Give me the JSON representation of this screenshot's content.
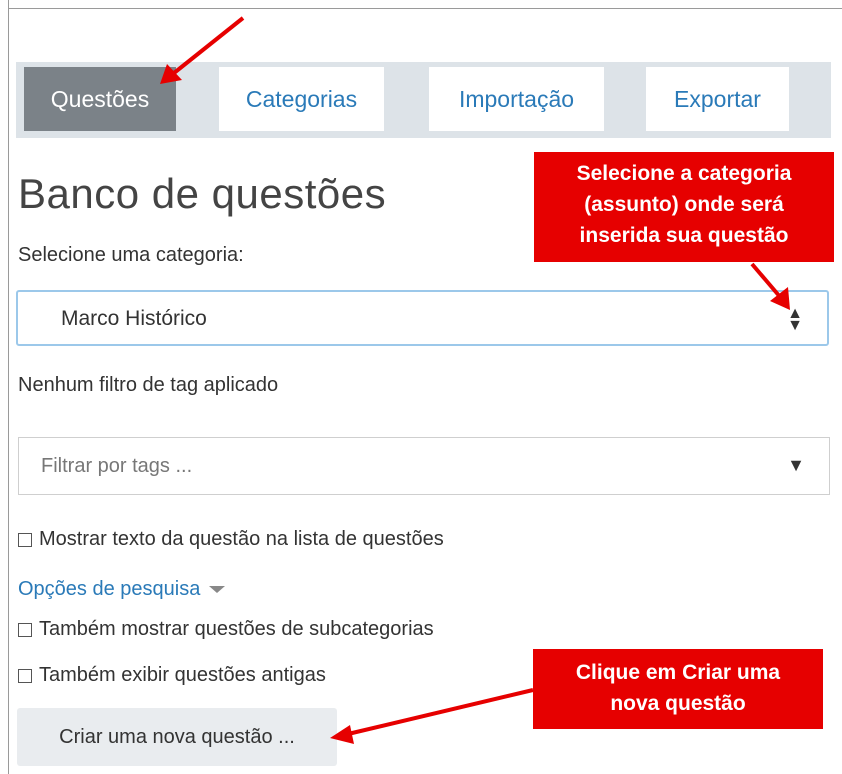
{
  "tabs": [
    {
      "label": "Questões",
      "active": true
    },
    {
      "label": "Categorias",
      "active": false
    },
    {
      "label": "Importação",
      "active": false
    },
    {
      "label": "Exportar",
      "active": false
    }
  ],
  "page_title": "Banco de questões",
  "category": {
    "label": "Selecione uma categoria:",
    "selected": "Marco Histórico"
  },
  "tag_filter": {
    "status": "Nenhum filtro de tag aplicado",
    "placeholder": "Filtrar por tags ..."
  },
  "options": {
    "show_question_text": "Mostrar texto da questão na lista de questões",
    "search_options_link": "Opções de pesquisa",
    "show_subcategories": "Também mostrar questões de subcategorias",
    "show_old": "Também exibir questões antigas"
  },
  "create_button": "Criar uma nova questão ...",
  "callouts": {
    "category_line1": "Selecione a categoria",
    "category_line2": "(assunto) onde será",
    "category_line3": "inserida sua questão",
    "create_line1": "Clique em Criar uma",
    "create_line2": "nova questão"
  },
  "colors": {
    "accent": "#2a7ab8",
    "active_tab": "#7b8288",
    "callout": "#e60000",
    "arrow": "#e60000"
  }
}
